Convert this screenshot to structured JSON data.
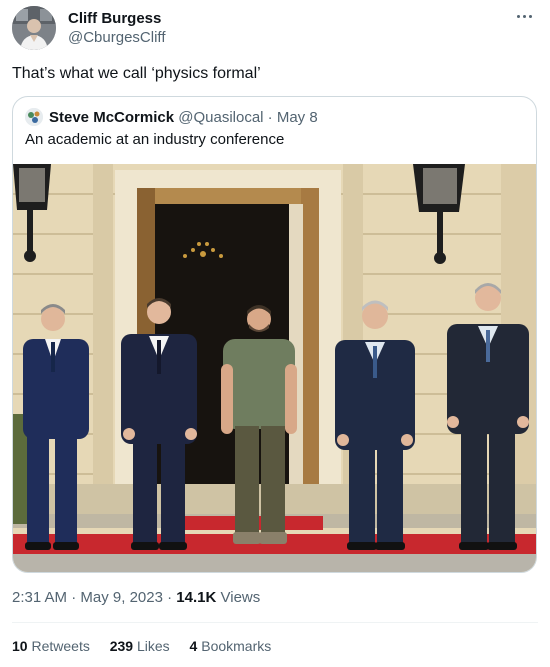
{
  "tweet": {
    "author_name": "Cliff Burgess",
    "author_handle": "@CburgesCliff",
    "text": "That’s what we call ‘physics formal’",
    "more_icon": "more-horizontal-icon"
  },
  "quoted": {
    "author_name": "Steve McCormick",
    "author_handle": "@Quasilocal",
    "separator": "·",
    "date": "May 8",
    "text": "An academic at an industry conference"
  },
  "meta": {
    "time": "2:31 AM",
    "sep1": "·",
    "date": "May 9, 2023",
    "sep2": "·",
    "views_count": "14.1K",
    "views_label": "Views"
  },
  "stats": {
    "retweets_count": "10",
    "retweets_label": "Retweets",
    "likes_count": "239",
    "likes_label": "Likes",
    "bookmarks_count": "4",
    "bookmarks_label": "Bookmarks"
  },
  "colors": {
    "primary_text": "#0f1419",
    "secondary_text": "#536471",
    "border": "#cfd9de",
    "carpet": "#c8282e"
  }
}
